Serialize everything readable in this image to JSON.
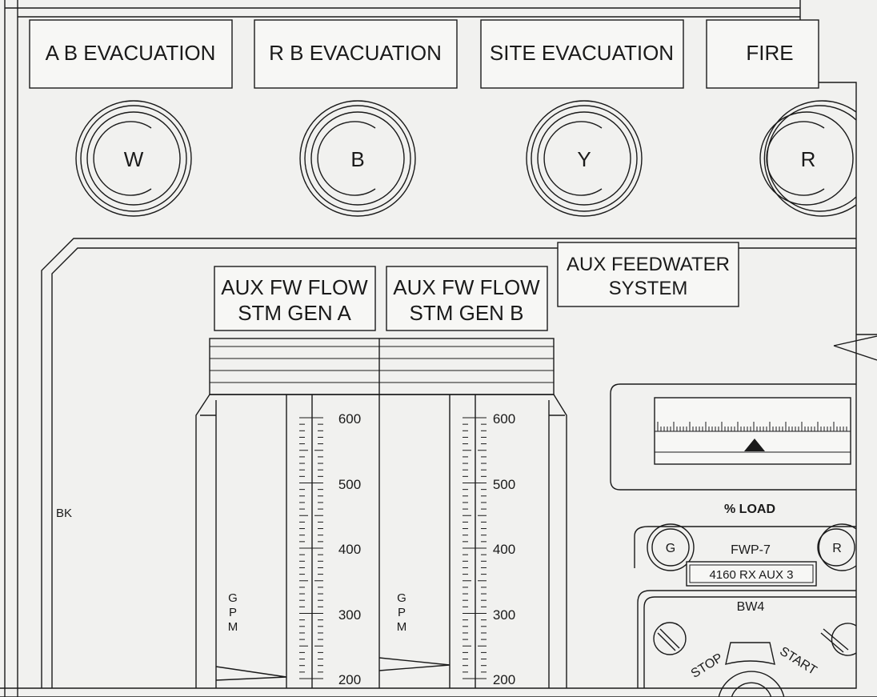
{
  "alarm_labels": [
    "A B EVACUATION",
    "R B EVACUATION",
    "SITE EVACUATION",
    "FIRE"
  ],
  "alarm_lights": [
    "W",
    "B",
    "Y",
    "R"
  ],
  "system_label": [
    "AUX FEEDWATER",
    "SYSTEM"
  ],
  "meter_a_label": [
    "AUX FW FLOW",
    "STM GEN A"
  ],
  "meter_b_label": [
    "AUX FW FLOW",
    "STM GEN B"
  ],
  "meter_scale_values": [
    "600",
    "500",
    "400",
    "300",
    "200"
  ],
  "gpm_letters": [
    "G",
    "P",
    "M"
  ],
  "bk_label": "BK",
  "load_label": "% LOAD",
  "pump_label": "FWP-7",
  "pump_breaker_tag": "4160 RX AUX 3",
  "pump_lights": [
    "G",
    "R"
  ],
  "switch_label": "BW4",
  "switch_positions": [
    "STOP",
    "START"
  ],
  "colors": {
    "line": "#1a1a1a",
    "panel": "#f1f1ef",
    "indicator": "#1a1a1a"
  }
}
